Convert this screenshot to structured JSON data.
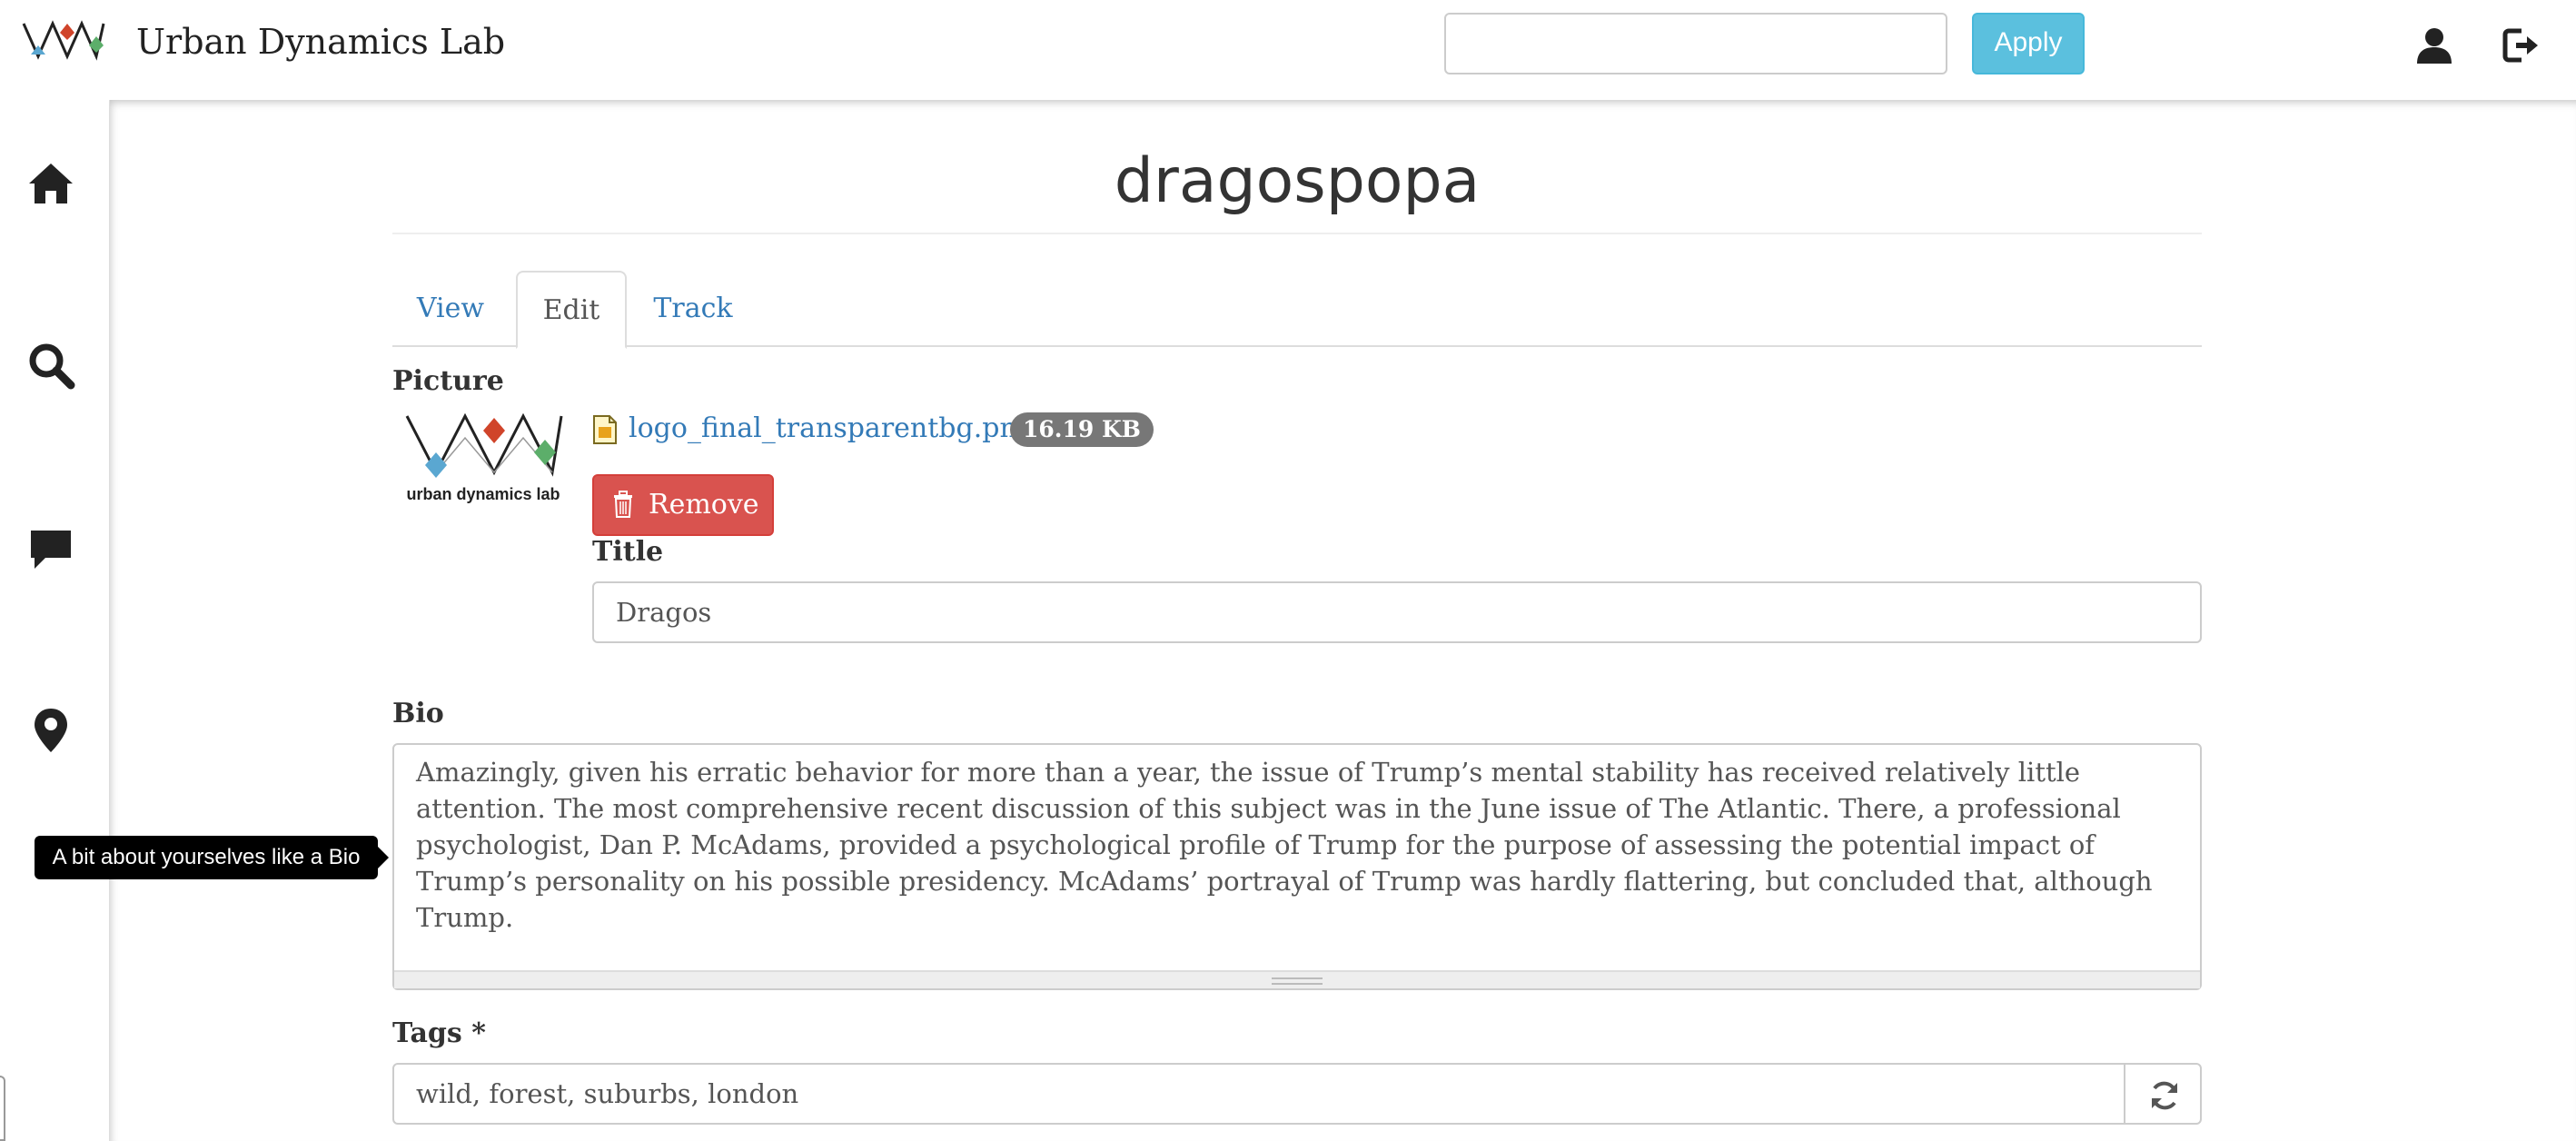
{
  "header": {
    "brand_name": "Urban Dynamics Lab",
    "search_value": "",
    "apply_label": "Apply",
    "icons": [
      "user-icon",
      "logout-icon"
    ]
  },
  "sidebar": {
    "items": [
      {
        "icon": "home-icon"
      },
      {
        "icon": "search-icon"
      },
      {
        "icon": "comment-icon"
      },
      {
        "icon": "map-marker-icon"
      }
    ]
  },
  "page": {
    "title": "dragospopa",
    "tabs": [
      {
        "label": "View",
        "active": false
      },
      {
        "label": "Edit",
        "active": true
      },
      {
        "label": "Track",
        "active": false
      }
    ]
  },
  "form": {
    "picture": {
      "label": "Picture",
      "logo_caption": "urban dynamics lab",
      "file_name": "logo_final_transparentbg.png",
      "file_size": "16.19 KB",
      "remove_label": "Remove"
    },
    "title": {
      "label": "Title",
      "value": "Dragos"
    },
    "bio": {
      "label": "Bio",
      "value": "Amazingly, given his erratic behavior for more than a year, the issue of Trump’s mental stability has received relatively little attention. The most comprehensive recent discussion of this subject was in the June issue of The Atlantic. There, a professional psychologist, Dan P. McAdams, provided a psychological profile of Trump for the purpose of assessing the potential impact of Trump’s personality on his possible presidency. McAdams’ portrayal of Trump was hardly flattering, but concluded that, although Trump.",
      "tooltip": "A bit about yourselves like a Bio"
    },
    "tags": {
      "label": "Tags *",
      "value": "wild, forest, suburbs, london"
    }
  },
  "colors": {
    "link": "#337ab7",
    "apply_bg": "#5bc0de",
    "remove_bg": "#d9534f",
    "badge_bg": "#777777",
    "logo_blue": "#5aa7d1",
    "logo_red": "#d0442a",
    "logo_green": "#5cae6a"
  }
}
